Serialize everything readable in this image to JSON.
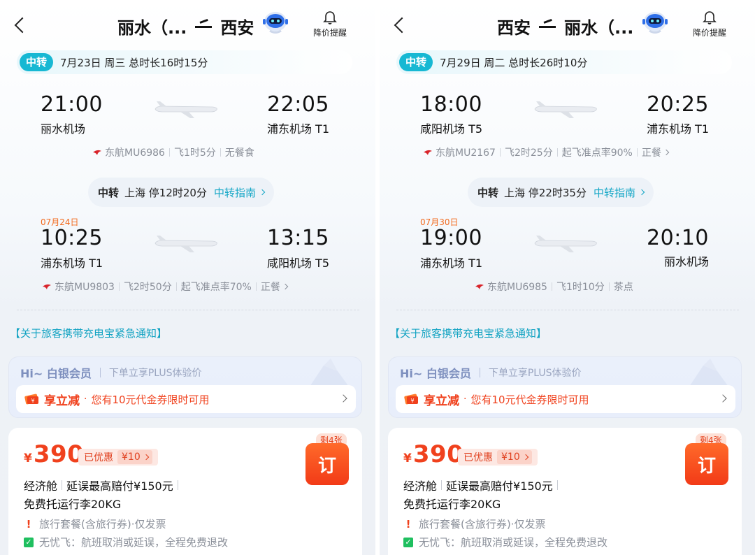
{
  "panels": [
    {
      "header": {
        "from": "丽水（...",
        "to": "西安",
        "bell_label": "降价提醒"
      },
      "info": {
        "tag": "中转",
        "text": "7月23日 周三   总时长16时15分"
      },
      "segments": [
        {
          "date": "",
          "dep_time": "21:00",
          "dep_airport": "丽水机场",
          "arr_time": "22:05",
          "arr_airport": "浦东机场 T1",
          "airline": "东航MU6986",
          "details": [
            "飞1时5分",
            "无餐食"
          ],
          "has_chevron": false
        },
        {
          "date": "07月24日",
          "dep_time": "10:25",
          "dep_airport": "浦东机场 T1",
          "arr_time": "13:15",
          "arr_airport": "咸阳机场 T5",
          "airline": "东航MU9803",
          "details": [
            "飞2时50分",
            "起飞准点率70%",
            "正餐"
          ],
          "has_chevron": true
        }
      ],
      "transfer": {
        "label": "中转",
        "text": "上海 停12时20分",
        "guide": "中转指南"
      },
      "notice": "【关于旅客携带充电宝紧急通知】",
      "member": {
        "title": "Hi~ 白银会员",
        "subtitle": "下单立享PLUS体验价",
        "coupon_strong": "享立减",
        "coupon_dot": "·",
        "coupon_text": "您有10元代金券限时可用"
      },
      "price": {
        "currency": "¥",
        "amount": "390",
        "discount_label": "已优惠",
        "discount_amount": "¥10",
        "remain": "剩4张",
        "book": "订",
        "cabin": "经济舱",
        "compensation": "延误最高赔付¥150元",
        "baggage": "免费托运行李20KG",
        "features": [
          "旅行套餐(含旅行券)·仅发票",
          "无忧飞：航班取消或延误，全程免费退改"
        ]
      }
    },
    {
      "header": {
        "from": "西安",
        "to": "丽水（...",
        "bell_label": "降价提醒"
      },
      "info": {
        "tag": "中转",
        "text": "7月29日 周二   总时长26时10分"
      },
      "segments": [
        {
          "date": "",
          "dep_time": "18:00",
          "dep_airport": "咸阳机场 T5",
          "arr_time": "20:25",
          "arr_airport": "浦东机场 T1",
          "airline": "东航MU2167",
          "details": [
            "飞2时25分",
            "起飞准点率90%",
            "正餐"
          ],
          "has_chevron": true
        },
        {
          "date": "07月30日",
          "dep_time": "19:00",
          "dep_airport": "浦东机场 T1",
          "arr_time": "20:10",
          "arr_airport": "丽水机场",
          "airline": "东航MU6985",
          "details": [
            "飞1时10分",
            "茶点"
          ],
          "has_chevron": false
        }
      ],
      "transfer": {
        "label": "中转",
        "text": "上海 停22时35分",
        "guide": "中转指南"
      },
      "notice": "【关于旅客携带充电宝紧急通知】",
      "member": {
        "title": "Hi~ 白银会员",
        "subtitle": "下单立享PLUS体验价",
        "coupon_strong": "享立减",
        "coupon_dot": "·",
        "coupon_text": "您有10元代金券限时可用"
      },
      "price": {
        "currency": "¥",
        "amount": "390",
        "discount_label": "已优惠",
        "discount_amount": "¥10",
        "remain": "剩4张",
        "book": "订",
        "cabin": "经济舱",
        "compensation": "延误最高赔付¥150元",
        "baggage": "免费托运行李20KG",
        "features": [
          "旅行套餐(含旅行券)·仅发票",
          "无忧飞：航班取消或延误，全程免费退改"
        ]
      }
    }
  ],
  "icons": {
    "back": "chevron-left-icon",
    "robot": "robot-assistant-icon",
    "bell": "bell-icon",
    "airline": "china-eastern-logo-icon",
    "plane": "airplane-icon",
    "coupon": "coupon-icon",
    "warn": "exclamation-icon",
    "ok": "thumbs-up-icon"
  },
  "colors": {
    "accent_teal": "#17b8d3",
    "price_red": "#f0411d",
    "date_orange": "#f26b1f",
    "ok_green": "#1fbf5f"
  }
}
